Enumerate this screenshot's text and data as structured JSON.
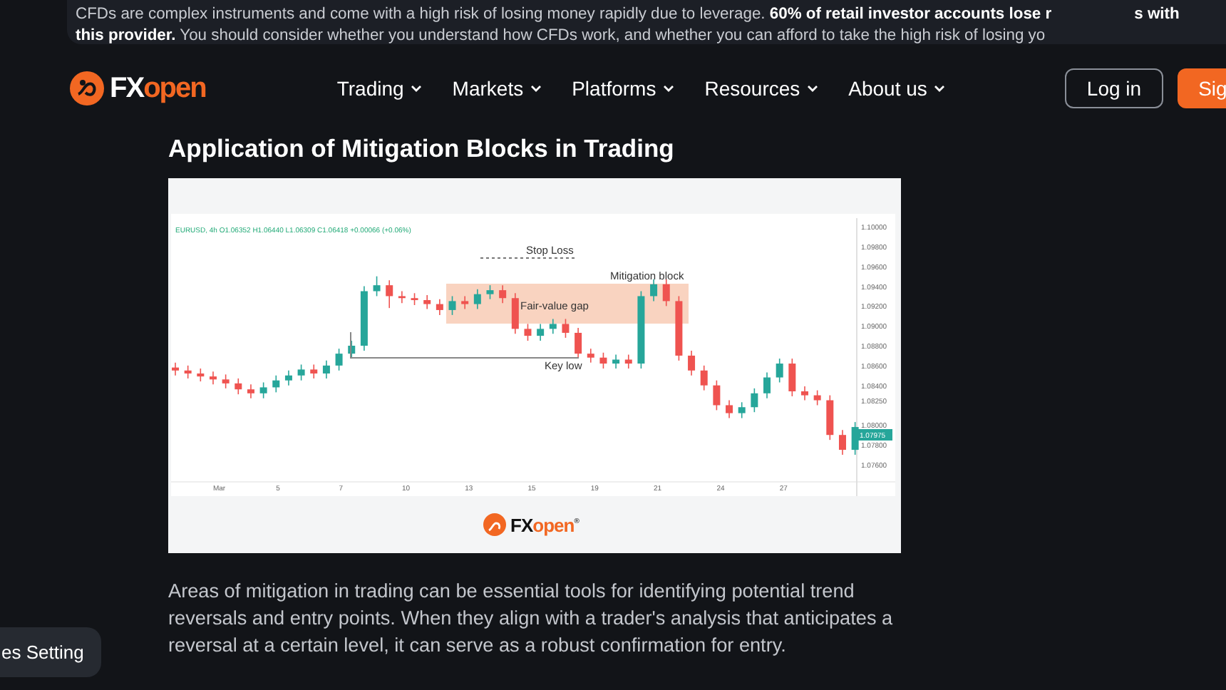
{
  "risk_banner": {
    "line_1": "CFDs are complex instruments and come with a high risk of losing money rapidly due to leverage. **60% of retail investor accounts lose r**",
    "line_1_end": "s with",
    "line_2": "**this provider.** You should consider whether you understand how CFDs work, and whether you can afford to take the high risk of losing yo"
  },
  "header": {
    "logo": {
      "prefix": "FX",
      "suffix": "open"
    },
    "nav": [
      {
        "label": "Trading"
      },
      {
        "label": "Markets"
      },
      {
        "label": "Platforms"
      },
      {
        "label": "Resources"
      },
      {
        "label": "About us"
      }
    ],
    "login_button": "Log in",
    "signup_button": "Sig"
  },
  "article": {
    "heading": "Application of Mitigation Blocks in Trading",
    "figure": {
      "legend": "EURUSD, 4h  O1.06352  H1.06440  L1.06309  C1.06418  +0.00066 (+0.06%)",
      "chart_data": {
        "type": "candlestick",
        "ylim": [
          1.07427,
          1.1013
        ],
        "categories": [
          null,
          null,
          null,
          "Mar",
          null,
          null,
          null,
          null,
          "5",
          null,
          null,
          null,
          null,
          "7",
          null,
          null,
          null,
          null,
          "10",
          null,
          null,
          null,
          null,
          "13",
          null,
          null,
          null,
          null,
          "15",
          null,
          null,
          null,
          null,
          "19",
          null,
          null,
          null,
          null,
          "21",
          null,
          null,
          null,
          null,
          "24",
          null,
          null,
          null,
          null,
          "27",
          null,
          null,
          null,
          null,
          null,
          null
        ],
        "ohlc": [
          [
            1.0858,
            1.0863,
            1.085,
            1.0855
          ],
          [
            1.0855,
            1.086,
            1.0847,
            1.0852
          ],
          [
            1.0852,
            1.0857,
            1.0844,
            1.0849
          ],
          [
            1.0849,
            1.0854,
            1.0841,
            1.0846
          ],
          [
            1.0846,
            1.0851,
            1.0837,
            1.0842
          ],
          [
            1.0842,
            1.0847,
            1.0831,
            1.0836
          ],
          [
            1.0836,
            1.0841,
            1.0827,
            1.0832
          ],
          [
            1.0832,
            1.0843,
            1.0827,
            1.0838
          ],
          [
            1.0838,
            1.085,
            1.0833,
            1.0845
          ],
          [
            1.0845,
            1.0855,
            1.084,
            1.085
          ],
          [
            1.085,
            1.0861,
            1.0845,
            1.0856
          ],
          [
            1.0856,
            1.0861,
            1.0847,
            1.0852
          ],
          [
            1.0852,
            1.0865,
            1.0847,
            1.086
          ],
          [
            1.086,
            1.0877,
            1.0855,
            1.0872
          ],
          [
            1.0872,
            1.0885,
            1.0867,
            1.088
          ],
          [
            1.088,
            1.094,
            1.0875,
            1.0935
          ],
          [
            1.0935,
            1.095,
            1.093,
            1.0941
          ],
          [
            1.0941,
            1.0946,
            1.0918,
            1.093
          ],
          [
            1.093,
            1.0935,
            1.0923,
            1.0928
          ],
          [
            1.0928,
            1.0933,
            1.0921,
            1.0926
          ],
          [
            1.0926,
            1.0931,
            1.0917,
            1.0922
          ],
          [
            1.0922,
            1.0927,
            1.0911,
            1.0916
          ],
          [
            1.0916,
            1.093,
            1.0911,
            1.0925
          ],
          [
            1.0925,
            1.093,
            1.0917,
            1.0922
          ],
          [
            1.0922,
            1.0937,
            1.0917,
            1.0932
          ],
          [
            1.0932,
            1.0941,
            1.0927,
            1.0936
          ],
          [
            1.0936,
            1.0941,
            1.0923,
            1.0928
          ],
          [
            1.0928,
            1.0933,
            1.0892,
            1.0897
          ],
          [
            1.0897,
            1.0902,
            1.0885,
            1.089
          ],
          [
            1.089,
            1.0902,
            1.0885,
            1.0897
          ],
          [
            1.0897,
            1.0907,
            1.0892,
            1.0902
          ],
          [
            1.0902,
            1.0907,
            1.0888,
            1.0893
          ],
          [
            1.0893,
            1.0898,
            1.0867,
            1.0872
          ],
          [
            1.0872,
            1.0877,
            1.0863,
            1.0868
          ],
          [
            1.0868,
            1.0873,
            1.0857,
            1.0862
          ],
          [
            1.0862,
            1.0871,
            1.0857,
            1.0866
          ],
          [
            1.0866,
            1.0871,
            1.0857,
            1.0862
          ],
          [
            1.0862,
            1.0935,
            1.0857,
            1.093
          ],
          [
            1.093,
            1.0947,
            1.0925,
            1.0942
          ],
          [
            1.0942,
            1.0947,
            1.092,
            1.0925
          ],
          [
            1.0925,
            1.093,
            1.0865,
            1.087
          ],
          [
            1.087,
            1.0875,
            1.085,
            1.0855
          ],
          [
            1.0855,
            1.086,
            1.0835,
            1.084
          ],
          [
            1.084,
            1.0845,
            1.0815,
            1.082
          ],
          [
            1.082,
            1.0825,
            1.0807,
            1.0812
          ],
          [
            1.0812,
            1.0823,
            1.0807,
            1.0818
          ],
          [
            1.0818,
            1.0837,
            1.0813,
            1.0832
          ],
          [
            1.0832,
            1.0853,
            1.0827,
            1.0848
          ],
          [
            1.0848,
            1.0867,
            1.0843,
            1.0862
          ],
          [
            1.0862,
            1.0867,
            1.0829,
            1.0834
          ],
          [
            1.0834,
            1.0839,
            1.0825,
            1.083
          ],
          [
            1.083,
            1.0835,
            1.082,
            1.0825
          ],
          [
            1.0825,
            1.083,
            1.0785,
            1.079
          ],
          [
            1.079,
            1.0795,
            1.077,
            1.0775
          ],
          [
            1.0775,
            1.0803,
            1.077,
            1.0798
          ]
        ],
        "yticks": [
          {
            "value": 1.1,
            "label": "1.10000"
          },
          {
            "value": 1.098,
            "label": "1.09800"
          },
          {
            "value": 1.096,
            "label": "1.09600"
          },
          {
            "value": 1.094,
            "label": "1.09400"
          },
          {
            "value": 1.092,
            "label": "1.09200"
          },
          {
            "value": 1.09,
            "label": "1.09000"
          },
          {
            "value": 1.088,
            "label": "1.08800"
          },
          {
            "value": 1.086,
            "label": "1.08600"
          },
          {
            "value": 1.084,
            "label": "1.08400"
          },
          {
            "value": 1.0825,
            "label": "1.08250"
          },
          {
            "value": 1.08,
            "label": "1.08000"
          },
          {
            "value": 1.078,
            "label": "1.07800"
          },
          {
            "value": 1.076,
            "label": "1.07600"
          }
        ]
      },
      "price_badge": "1.07975",
      "annotations": [
        {
          "kind": "stop",
          "text": "Stop Loss"
        },
        {
          "kind": "label",
          "text": "Mitigation block"
        },
        {
          "kind": "zone",
          "text": "Fair-value gap"
        },
        {
          "kind": "low",
          "text": "Key low"
        }
      ],
      "logo": {
        "prefix": "FX",
        "suffix": "open",
        "mark": "®"
      }
    },
    "paragraph": "Areas of mitigation in trading can be essential tools for identifying potential trend reversals and entry points. When they align with a trader's analysis that anticipates a reversal at a certain level, it can serve as a robust confirmation for entry."
  },
  "cookie_button": "es Setting"
}
